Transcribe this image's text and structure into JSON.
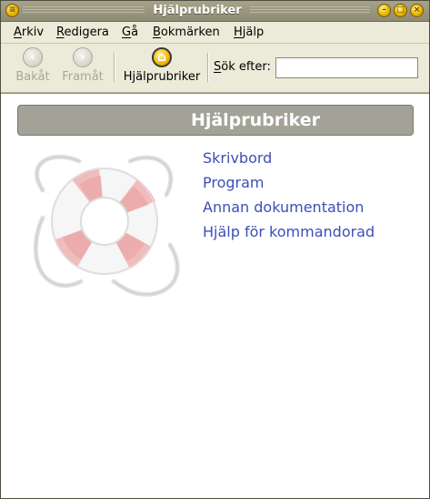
{
  "window": {
    "title": "Hjälprubriker"
  },
  "menubar": {
    "items": [
      {
        "first": "A",
        "rest": "rkiv"
      },
      {
        "first": "R",
        "rest": "edigera"
      },
      {
        "first": "G",
        "rest": "å"
      },
      {
        "first": "B",
        "rest": "okmärken"
      },
      {
        "first": "H",
        "rest": "jälp"
      }
    ]
  },
  "toolbar": {
    "back_label": "Bakåt",
    "forward_label": "Framåt",
    "home_label": "Hjälprubriker",
    "search_label_first": "S",
    "search_label_rest": "ök efter:",
    "search_value": ""
  },
  "content": {
    "heading": "Hjälprubriker",
    "links": [
      "Skrivbord",
      "Program",
      "Annan dokumentation",
      "Hjälp för kommandorad"
    ]
  },
  "colors": {
    "link": "#3b4fb8",
    "heading_bg": "#a3a296",
    "titlebar": "#9a977f"
  }
}
